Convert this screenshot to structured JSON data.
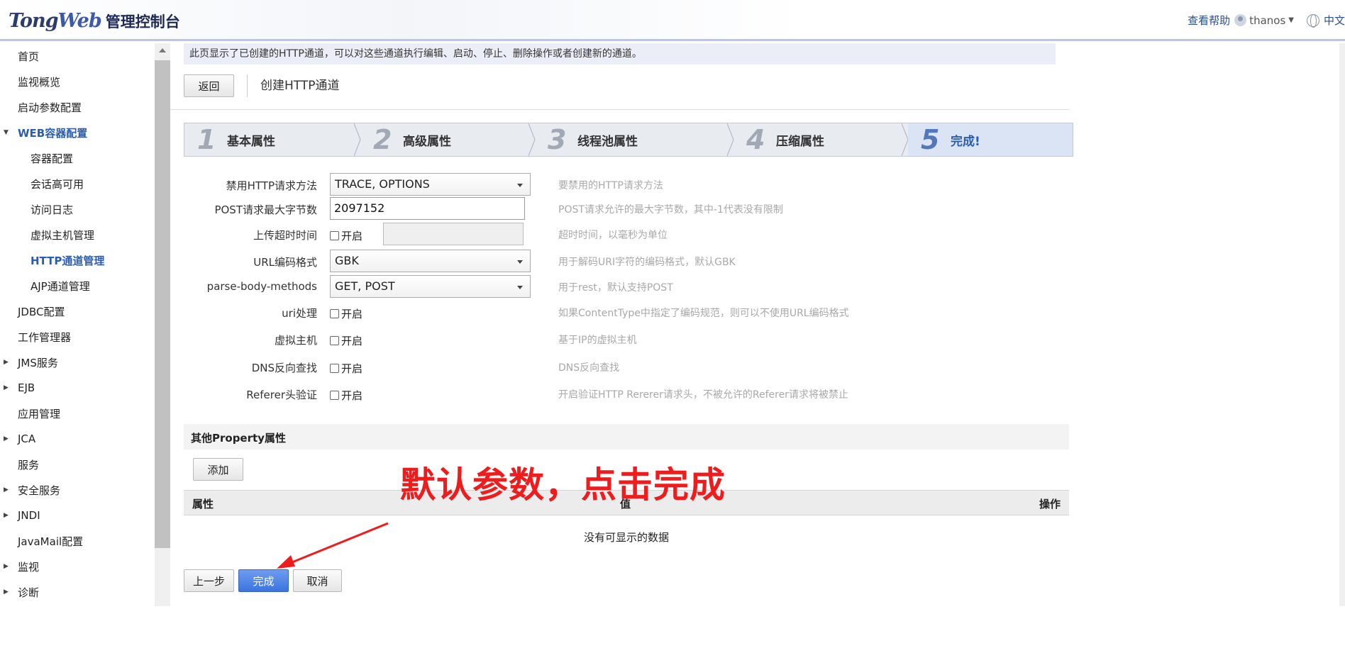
{
  "header": {
    "logo_main": "Tong",
    "logo_w": "Web",
    "logo_sub": "管理控制台",
    "help": "查看帮助",
    "user": "thanos",
    "language": "中文"
  },
  "sidebar": {
    "items": [
      {
        "label": "首页",
        "level": 0,
        "arrow": ""
      },
      {
        "label": "监视概览",
        "level": 0,
        "arrow": ""
      },
      {
        "label": "启动参数配置",
        "level": 0,
        "arrow": ""
      },
      {
        "label": "WEB容器配置",
        "level": 0,
        "arrow": "▼",
        "active": true
      },
      {
        "label": "容器配置",
        "level": 1,
        "arrow": ""
      },
      {
        "label": "会话高可用",
        "level": 1,
        "arrow": ""
      },
      {
        "label": "访问日志",
        "level": 1,
        "arrow": ""
      },
      {
        "label": "虚拟主机管理",
        "level": 1,
        "arrow": ""
      },
      {
        "label": "HTTP通道管理",
        "level": 1,
        "arrow": "",
        "active": true
      },
      {
        "label": "AJP通道管理",
        "level": 1,
        "arrow": ""
      },
      {
        "label": "JDBC配置",
        "level": 0,
        "arrow": ""
      },
      {
        "label": "工作管理器",
        "level": 0,
        "arrow": ""
      },
      {
        "label": "JMS服务",
        "level": 0,
        "arrow": "▶"
      },
      {
        "label": "EJB",
        "level": 0,
        "arrow": "▶"
      },
      {
        "label": "应用管理",
        "level": 0,
        "arrow": ""
      },
      {
        "label": "JCA",
        "level": 0,
        "arrow": "▶"
      },
      {
        "label": "服务",
        "level": 0,
        "arrow": ""
      },
      {
        "label": "安全服务",
        "level": 0,
        "arrow": "▶"
      },
      {
        "label": "JNDI",
        "level": 0,
        "arrow": "▶"
      },
      {
        "label": "JavaMail配置",
        "level": 0,
        "arrow": ""
      },
      {
        "label": "监视",
        "level": 0,
        "arrow": "▶"
      },
      {
        "label": "诊断",
        "level": 0,
        "arrow": "▶"
      }
    ]
  },
  "main": {
    "info": "此页显示了已创建的HTTP通道，可以对这些通道执行编辑、启动、停止、删除操作或者创建新的通道。",
    "back_label": "返回",
    "title": "创建HTTP通道",
    "steps": [
      {
        "num": "1",
        "label": "基本属性"
      },
      {
        "num": "2",
        "label": "高级属性"
      },
      {
        "num": "3",
        "label": "线程池属性"
      },
      {
        "num": "4",
        "label": "压缩属性"
      },
      {
        "num": "5",
        "label": "完成!"
      }
    ],
    "form": {
      "disabled_methods": {
        "label": "禁用HTTP请求方法",
        "value": "TRACE, OPTIONS",
        "hint": "要禁用的HTTP请求方法"
      },
      "post_max": {
        "label": "POST请求最大字节数",
        "value": "2097152",
        "hint": "POST请求允许的最大字节数，其中-1代表没有限制"
      },
      "upload_timeout": {
        "label": "上传超时时间",
        "check": "开启",
        "hint": "超时时间，以毫秒为单位"
      },
      "url_encoding": {
        "label": "URL编码格式",
        "value": "GBK",
        "hint": "用于解码URI字符的编码格式，默认GBK"
      },
      "parse_body": {
        "label": "parse-body-methods",
        "value": "GET, POST",
        "hint": "用于rest，默认支持POST"
      },
      "uri_handling": {
        "label": "uri处理",
        "check": "开启",
        "hint": "如果ContentType中指定了编码规范，则可以不使用URL编码格式"
      },
      "virtual_host": {
        "label": "虚拟主机",
        "check": "开启",
        "hint": "基于IP的虚拟主机"
      },
      "dns_lookup": {
        "label": "DNS反向查找",
        "check": "开启",
        "hint": "DNS反向查找"
      },
      "referer_check": {
        "label": "Referer头验证",
        "check": "开启",
        "hint": "开启验证HTTP Rererer请求头，不被允许的Referer请求将被禁止"
      }
    },
    "property_section": {
      "title": "其他Property属性",
      "add_label": "添加",
      "col_name": "属性",
      "col_value": "值",
      "col_action": "操作",
      "empty": "没有可显示的数据"
    },
    "footer": {
      "prev_label": "上一步",
      "finish_label": "完成",
      "cancel_label": "取消"
    },
    "annotation": "默认参数，点击完成"
  },
  "colors": {
    "accent": "#2a5db0",
    "finish_button": "#3b74e0",
    "annotation": "#ee1c1c"
  }
}
